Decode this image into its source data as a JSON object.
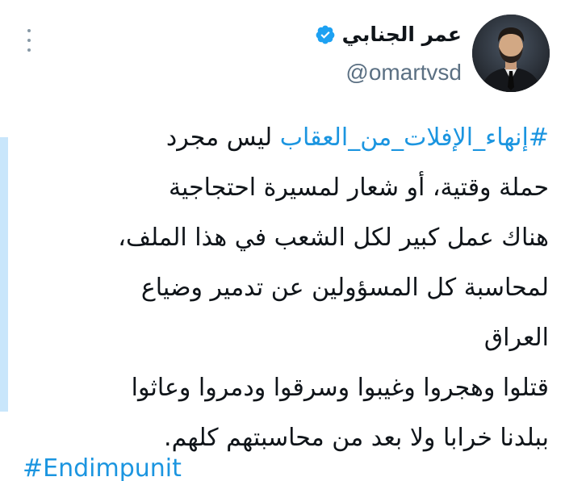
{
  "tweet": {
    "author": {
      "display_name": "عمر الجنابي",
      "handle": "@omartvsd",
      "verified": true,
      "avatar_icon": "profile-photo"
    },
    "hashtag": "#إنهاء_الإفلات_من_العقاب",
    "lines": [
      "ليس مجرد",
      "حملة وقتية، أو شعار لمسيرة احتجاجية",
      "هناك عمل كبير لكل الشعب في هذا الملف،",
      "لمحاسبة كل المسؤولين عن تدمير وضياع",
      "العراق",
      "قتلوا وهجروا وغيبوا وسرقوا ودمروا وعاثوا",
      "ببلدنا خرابا ولا بعد من محاسبتهم كلهم."
    ],
    "next_hashtag_peek": "#Endimpunit"
  },
  "colors": {
    "hashtag": "#1b95e0",
    "verified": "#1da1f2",
    "handle": "#5b7083",
    "accent_bar": "#c9e6fb"
  },
  "icons": {
    "more": "vertical-ellipsis-icon",
    "verified": "verified-badge-icon"
  }
}
